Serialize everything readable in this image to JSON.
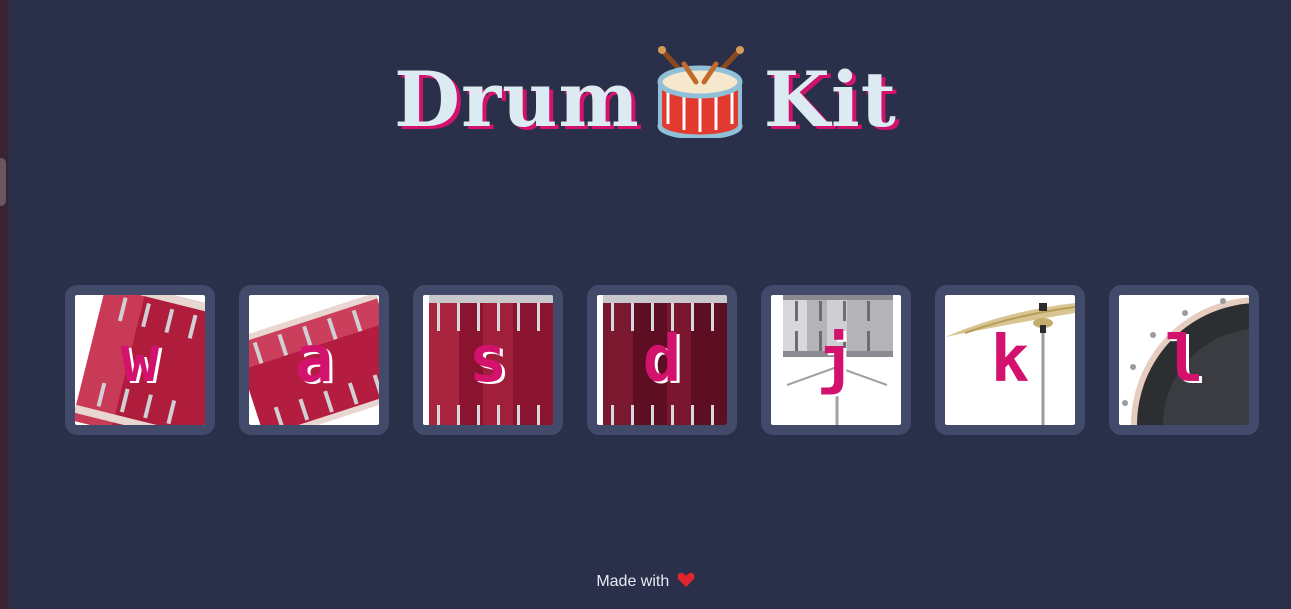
{
  "title": {
    "word1": "Drum",
    "icon": "drum-emoji",
    "word2": "Kit"
  },
  "pads": [
    {
      "key": "w",
      "image": "red-tom-tilted-icon"
    },
    {
      "key": "a",
      "image": "red-tom-angled-icon"
    },
    {
      "key": "s",
      "image": "red-floor-tom-icon"
    },
    {
      "key": "d",
      "image": "dark-red-floor-tom-icon"
    },
    {
      "key": "j",
      "image": "silver-snare-icon"
    },
    {
      "key": "k",
      "image": "cymbal-icon"
    },
    {
      "key": "l",
      "image": "bass-drum-icon"
    }
  ],
  "footer": {
    "text": "Made with",
    "icon": "heart-icon"
  },
  "colors": {
    "background": "#2a3049",
    "pad_frame": "#424a6a",
    "accent": "#d3126e",
    "title": "#dceaf2"
  }
}
